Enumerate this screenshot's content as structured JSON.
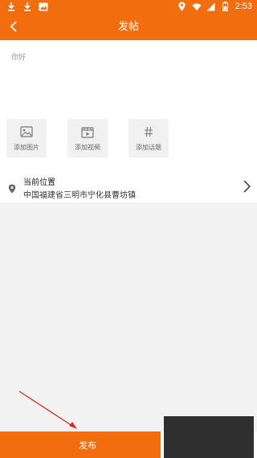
{
  "status_bar": {
    "time": "2:53",
    "left_icons": [
      "download-icon",
      "download-icon",
      "image-icon"
    ],
    "right_icons": [
      "location-icon",
      "wifi-icon",
      "signal-icon",
      "battery-icon"
    ]
  },
  "header": {
    "title": "发帖",
    "back_icon": "chevron-left-icon"
  },
  "editor": {
    "placeholder": "你好"
  },
  "tools": [
    {
      "icon": "image-icon",
      "label": "添加图片"
    },
    {
      "icon": "video-icon",
      "label": "添加视频"
    },
    {
      "icon": "hash-icon",
      "label": "添加话题"
    }
  ],
  "location": {
    "icon": "location-pin-icon",
    "title": "当前位置",
    "address": "中国福建省三明市宁化县曹坊镇",
    "arrow_icon": "chevron-right-icon"
  },
  "footer": {
    "publish_label": "发布"
  },
  "colors": {
    "brand": "#f26d0d",
    "background": "#f2f2f2",
    "annotation": "#e0251b"
  }
}
